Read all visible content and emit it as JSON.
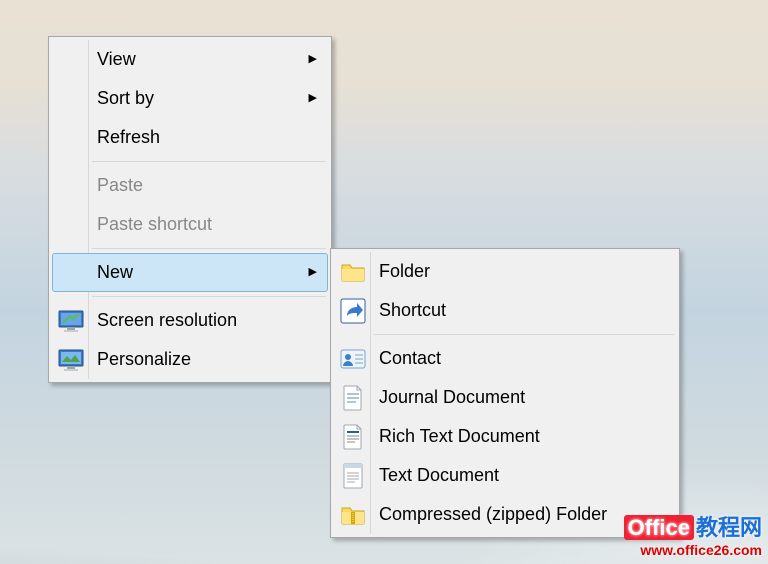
{
  "context_menu": {
    "items": [
      {
        "label": "View",
        "submenu": true,
        "disabled": false,
        "icon": null
      },
      {
        "label": "Sort by",
        "submenu": true,
        "disabled": false,
        "icon": null
      },
      {
        "label": "Refresh",
        "submenu": false,
        "disabled": false,
        "icon": null
      },
      {
        "sep": true
      },
      {
        "label": "Paste",
        "submenu": false,
        "disabled": true,
        "icon": null
      },
      {
        "label": "Paste shortcut",
        "submenu": false,
        "disabled": true,
        "icon": null
      },
      {
        "sep": true
      },
      {
        "label": "New",
        "submenu": true,
        "disabled": false,
        "icon": null,
        "highlight": true
      },
      {
        "sep": true
      },
      {
        "label": "Screen resolution",
        "submenu": false,
        "disabled": false,
        "icon": "screen-resolution-icon"
      },
      {
        "label": "Personalize",
        "submenu": false,
        "disabled": false,
        "icon": "personalize-icon"
      }
    ]
  },
  "submenu_new": {
    "items": [
      {
        "label": "Folder",
        "icon": "folder-icon"
      },
      {
        "label": "Shortcut",
        "icon": "shortcut-icon"
      },
      {
        "sep": true
      },
      {
        "label": "Contact",
        "icon": "contact-icon"
      },
      {
        "label": "Journal Document",
        "icon": "journal-icon"
      },
      {
        "label": "Rich Text Document",
        "icon": "rtf-icon"
      },
      {
        "label": "Text Document",
        "icon": "text-icon"
      },
      {
        "label": "Compressed (zipped) Folder",
        "icon": "zip-icon"
      }
    ]
  },
  "watermark": {
    "title_prefix": "Office",
    "title_suffix": "教程网",
    "url": "www.office26.com"
  }
}
